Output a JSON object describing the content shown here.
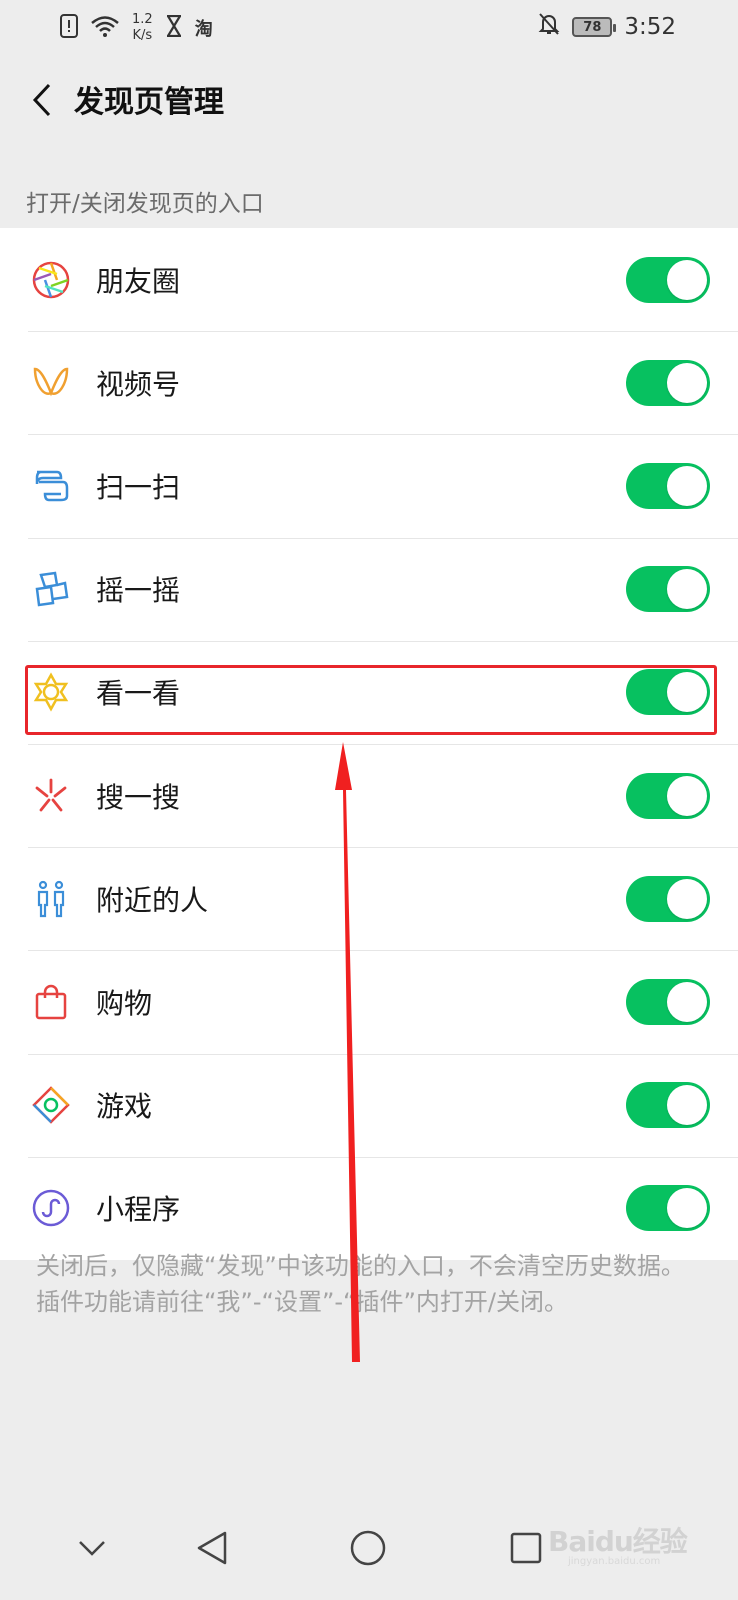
{
  "status_bar": {
    "net_speed_value": "1.2",
    "net_speed_unit": "K/s",
    "taobao_glyph": "淘",
    "battery": "78",
    "time": "3:52",
    "icons": [
      "alert-icon",
      "wifi-icon",
      "hourglass-icon",
      "taobao-icon",
      "bell-off-icon",
      "battery-icon"
    ]
  },
  "header": {
    "title": "发现页管理",
    "back_icon": "chevron-left-icon"
  },
  "section_label": "打开/关闭发现页的入口",
  "items": [
    {
      "label": "朋友圈",
      "icon": "moments-icon",
      "enabled": true
    },
    {
      "label": "视频号",
      "icon": "channels-icon",
      "enabled": true
    },
    {
      "label": "扫一扫",
      "icon": "scan-icon",
      "enabled": true
    },
    {
      "label": "摇一摇",
      "icon": "shake-icon",
      "enabled": true
    },
    {
      "label": "看一看",
      "icon": "top-stories-icon",
      "enabled": true
    },
    {
      "label": "搜一搜",
      "icon": "search-icon",
      "enabled": true
    },
    {
      "label": "附近的人",
      "icon": "people-nearby-icon",
      "enabled": true
    },
    {
      "label": "购物",
      "icon": "shopping-bag-icon",
      "enabled": true
    },
    {
      "label": "游戏",
      "icon": "games-icon",
      "enabled": true
    },
    {
      "label": "小程序",
      "icon": "mini-program-icon",
      "enabled": true
    }
  ],
  "footer_note": "关闭后，仅隐藏“发现”中该功能的入口，不会清空历史数据。插件功能请前往“我”-“设置”-“插件”内打开/关闭。",
  "watermark": {
    "text": "Baidu经验",
    "sub": "jingyan.baidu.com"
  },
  "colors": {
    "toggle_on": "#07c160",
    "highlight": "#e8262b",
    "background": "#ededed"
  }
}
